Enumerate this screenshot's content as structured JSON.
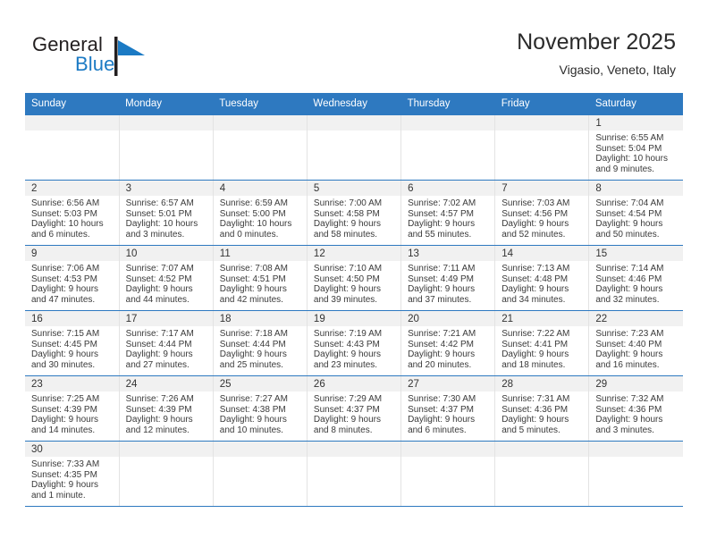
{
  "brand": {
    "name_top": "General",
    "name_bottom": "Blue",
    "mark_icon": "blue-flag-triangle-icon",
    "accent_color": "#1b7ac4"
  },
  "header": {
    "title": "November 2025",
    "subtitle": "Vigasio, Veneto, Italy"
  },
  "theme": {
    "header_row_bg": "#2e79c0",
    "daynum_band_bg": "#f1f1f1",
    "row_separator": "#2e79c0"
  },
  "calendar": {
    "weekday_headers": [
      "Sunday",
      "Monday",
      "Tuesday",
      "Wednesday",
      "Thursday",
      "Friday",
      "Saturday"
    ],
    "weeks": [
      [
        {
          "day": "",
          "lines": []
        },
        {
          "day": "",
          "lines": []
        },
        {
          "day": "",
          "lines": []
        },
        {
          "day": "",
          "lines": []
        },
        {
          "day": "",
          "lines": []
        },
        {
          "day": "",
          "lines": []
        },
        {
          "day": "1",
          "lines": [
            "Sunrise: 6:55 AM",
            "Sunset: 5:04 PM",
            "Daylight: 10 hours",
            "and 9 minutes."
          ]
        }
      ],
      [
        {
          "day": "2",
          "lines": [
            "Sunrise: 6:56 AM",
            "Sunset: 5:03 PM",
            "Daylight: 10 hours",
            "and 6 minutes."
          ]
        },
        {
          "day": "3",
          "lines": [
            "Sunrise: 6:57 AM",
            "Sunset: 5:01 PM",
            "Daylight: 10 hours",
            "and 3 minutes."
          ]
        },
        {
          "day": "4",
          "lines": [
            "Sunrise: 6:59 AM",
            "Sunset: 5:00 PM",
            "Daylight: 10 hours",
            "and 0 minutes."
          ]
        },
        {
          "day": "5",
          "lines": [
            "Sunrise: 7:00 AM",
            "Sunset: 4:58 PM",
            "Daylight: 9 hours",
            "and 58 minutes."
          ]
        },
        {
          "day": "6",
          "lines": [
            "Sunrise: 7:02 AM",
            "Sunset: 4:57 PM",
            "Daylight: 9 hours",
            "and 55 minutes."
          ]
        },
        {
          "day": "7",
          "lines": [
            "Sunrise: 7:03 AM",
            "Sunset: 4:56 PM",
            "Daylight: 9 hours",
            "and 52 minutes."
          ]
        },
        {
          "day": "8",
          "lines": [
            "Sunrise: 7:04 AM",
            "Sunset: 4:54 PM",
            "Daylight: 9 hours",
            "and 50 minutes."
          ]
        }
      ],
      [
        {
          "day": "9",
          "lines": [
            "Sunrise: 7:06 AM",
            "Sunset: 4:53 PM",
            "Daylight: 9 hours",
            "and 47 minutes."
          ]
        },
        {
          "day": "10",
          "lines": [
            "Sunrise: 7:07 AM",
            "Sunset: 4:52 PM",
            "Daylight: 9 hours",
            "and 44 minutes."
          ]
        },
        {
          "day": "11",
          "lines": [
            "Sunrise: 7:08 AM",
            "Sunset: 4:51 PM",
            "Daylight: 9 hours",
            "and 42 minutes."
          ]
        },
        {
          "day": "12",
          "lines": [
            "Sunrise: 7:10 AM",
            "Sunset: 4:50 PM",
            "Daylight: 9 hours",
            "and 39 minutes."
          ]
        },
        {
          "day": "13",
          "lines": [
            "Sunrise: 7:11 AM",
            "Sunset: 4:49 PM",
            "Daylight: 9 hours",
            "and 37 minutes."
          ]
        },
        {
          "day": "14",
          "lines": [
            "Sunrise: 7:13 AM",
            "Sunset: 4:48 PM",
            "Daylight: 9 hours",
            "and 34 minutes."
          ]
        },
        {
          "day": "15",
          "lines": [
            "Sunrise: 7:14 AM",
            "Sunset: 4:46 PM",
            "Daylight: 9 hours",
            "and 32 minutes."
          ]
        }
      ],
      [
        {
          "day": "16",
          "lines": [
            "Sunrise: 7:15 AM",
            "Sunset: 4:45 PM",
            "Daylight: 9 hours",
            "and 30 minutes."
          ]
        },
        {
          "day": "17",
          "lines": [
            "Sunrise: 7:17 AM",
            "Sunset: 4:44 PM",
            "Daylight: 9 hours",
            "and 27 minutes."
          ]
        },
        {
          "day": "18",
          "lines": [
            "Sunrise: 7:18 AM",
            "Sunset: 4:44 PM",
            "Daylight: 9 hours",
            "and 25 minutes."
          ]
        },
        {
          "day": "19",
          "lines": [
            "Sunrise: 7:19 AM",
            "Sunset: 4:43 PM",
            "Daylight: 9 hours",
            "and 23 minutes."
          ]
        },
        {
          "day": "20",
          "lines": [
            "Sunrise: 7:21 AM",
            "Sunset: 4:42 PM",
            "Daylight: 9 hours",
            "and 20 minutes."
          ]
        },
        {
          "day": "21",
          "lines": [
            "Sunrise: 7:22 AM",
            "Sunset: 4:41 PM",
            "Daylight: 9 hours",
            "and 18 minutes."
          ]
        },
        {
          "day": "22",
          "lines": [
            "Sunrise: 7:23 AM",
            "Sunset: 4:40 PM",
            "Daylight: 9 hours",
            "and 16 minutes."
          ]
        }
      ],
      [
        {
          "day": "23",
          "lines": [
            "Sunrise: 7:25 AM",
            "Sunset: 4:39 PM",
            "Daylight: 9 hours",
            "and 14 minutes."
          ]
        },
        {
          "day": "24",
          "lines": [
            "Sunrise: 7:26 AM",
            "Sunset: 4:39 PM",
            "Daylight: 9 hours",
            "and 12 minutes."
          ]
        },
        {
          "day": "25",
          "lines": [
            "Sunrise: 7:27 AM",
            "Sunset: 4:38 PM",
            "Daylight: 9 hours",
            "and 10 minutes."
          ]
        },
        {
          "day": "26",
          "lines": [
            "Sunrise: 7:29 AM",
            "Sunset: 4:37 PM",
            "Daylight: 9 hours",
            "and 8 minutes."
          ]
        },
        {
          "day": "27",
          "lines": [
            "Sunrise: 7:30 AM",
            "Sunset: 4:37 PM",
            "Daylight: 9 hours",
            "and 6 minutes."
          ]
        },
        {
          "day": "28",
          "lines": [
            "Sunrise: 7:31 AM",
            "Sunset: 4:36 PM",
            "Daylight: 9 hours",
            "and 5 minutes."
          ]
        },
        {
          "day": "29",
          "lines": [
            "Sunrise: 7:32 AM",
            "Sunset: 4:36 PM",
            "Daylight: 9 hours",
            "and 3 minutes."
          ]
        }
      ],
      [
        {
          "day": "30",
          "lines": [
            "Sunrise: 7:33 AM",
            "Sunset: 4:35 PM",
            "Daylight: 9 hours",
            "and 1 minute."
          ]
        },
        {
          "day": "",
          "lines": []
        },
        {
          "day": "",
          "lines": []
        },
        {
          "day": "",
          "lines": []
        },
        {
          "day": "",
          "lines": []
        },
        {
          "day": "",
          "lines": []
        },
        {
          "day": "",
          "lines": []
        }
      ]
    ]
  }
}
